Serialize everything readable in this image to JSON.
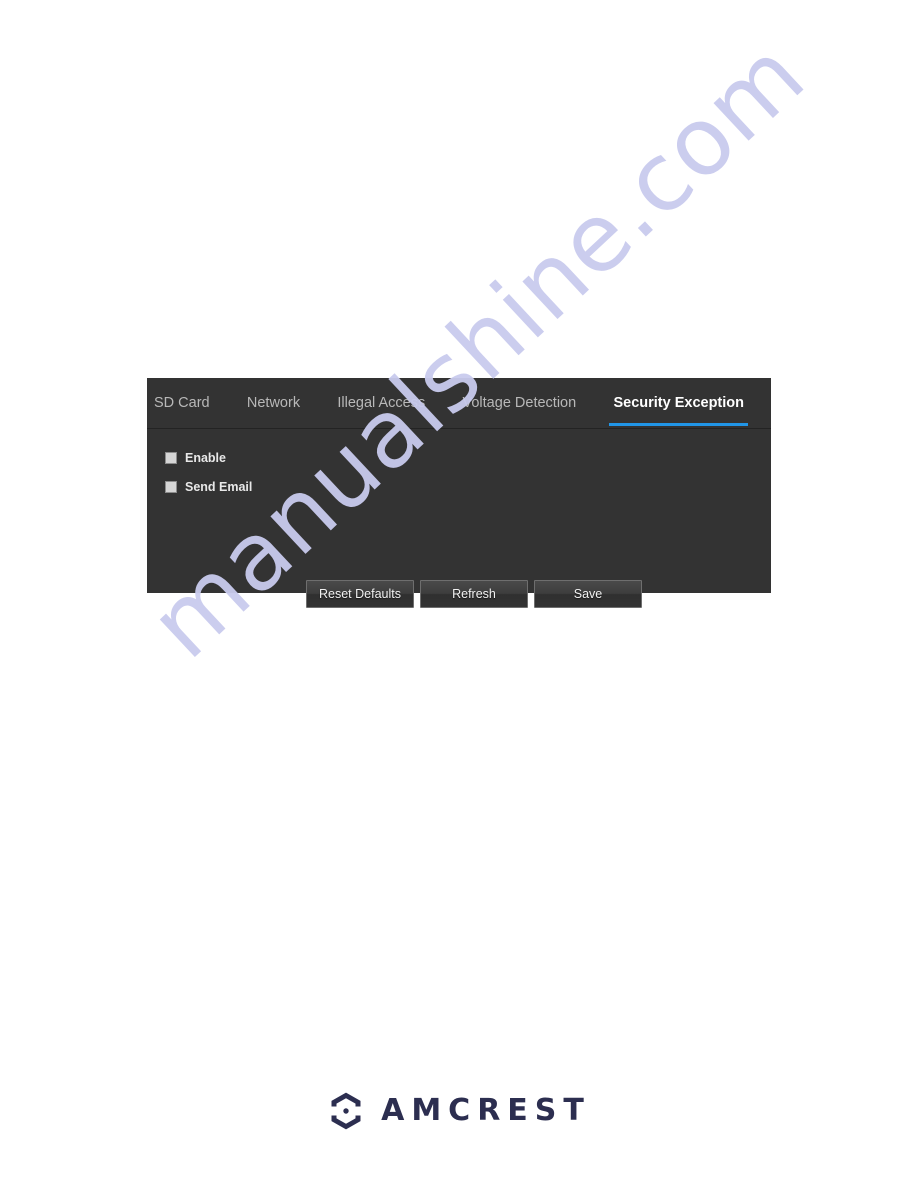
{
  "page": {
    "background_color": "#ffffff",
    "watermark_text": "manualshine.com",
    "watermark_color": "#c9cbee"
  },
  "panel": {
    "background_color": "#333333",
    "accent_color": "#2196e8",
    "tabs": [
      {
        "label": "SD Card",
        "active": false
      },
      {
        "label": "Network",
        "active": false
      },
      {
        "label": "Illegal Access",
        "active": false
      },
      {
        "label": "Voltage Detection",
        "active": false
      },
      {
        "label": "Security Exception",
        "active": true
      }
    ],
    "checkboxes": [
      {
        "label": "Enable",
        "checked": false
      },
      {
        "label": "Send Email",
        "checked": false
      }
    ],
    "buttons": [
      {
        "label": "Reset Defaults"
      },
      {
        "label": "Refresh"
      },
      {
        "label": "Save"
      }
    ]
  },
  "footer": {
    "brand_name": "AMCREST",
    "brand_color": "#2c2e50",
    "logo_icon": "amcrest-hexagon-icon"
  }
}
